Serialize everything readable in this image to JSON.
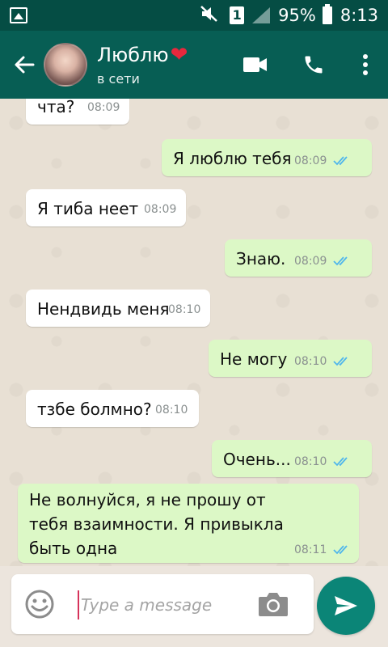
{
  "status_bar": {
    "battery": "95%",
    "time": "8:13",
    "sim_badge": "1"
  },
  "header": {
    "contact_name": "Люблю",
    "status": "в сети",
    "heart": "❤"
  },
  "messages": [
    {
      "text": "чта?",
      "time": "08:09",
      "direction": "in"
    },
    {
      "text": "Я люблю тебя",
      "time": "08:09",
      "direction": "out",
      "read": true
    },
    {
      "text": "Я тиба неет",
      "time": "08:09",
      "direction": "in"
    },
    {
      "text": "Знаю.",
      "time": "08:09",
      "direction": "out",
      "read": true
    },
    {
      "text": "Нендвидь меня",
      "time": "08:10",
      "direction": "in"
    },
    {
      "text": "Не могу",
      "time": "08:10",
      "direction": "out",
      "read": true
    },
    {
      "text": "тзбе болмно?",
      "time": "08:10",
      "direction": "in"
    },
    {
      "text": "Очень...",
      "time": "08:10",
      "direction": "out",
      "read": true
    },
    {
      "lines": [
        "Не волнуйся, я не прошу от",
        "тебя взаимности. Я привыкла",
        "быть одна"
      ],
      "time": "08:11",
      "direction": "out",
      "read": true
    }
  ],
  "input": {
    "placeholder": "Type a message",
    "value": ""
  },
  "colors": {
    "header": "#075e54",
    "status_bar": "#054d44",
    "outgoing_bubble": "#dcf8c6",
    "incoming_bubble": "#ffffff",
    "read_ticks": "#4fb6ec",
    "send_button": "#0b8577"
  },
  "icons": [
    "image-icon",
    "mute-icon",
    "signal-icon",
    "battery-icon",
    "back-arrow-icon",
    "video-call-icon",
    "phone-icon",
    "more-options-icon",
    "emoji-icon",
    "camera-icon",
    "send-icon",
    "double-check-icon"
  ]
}
